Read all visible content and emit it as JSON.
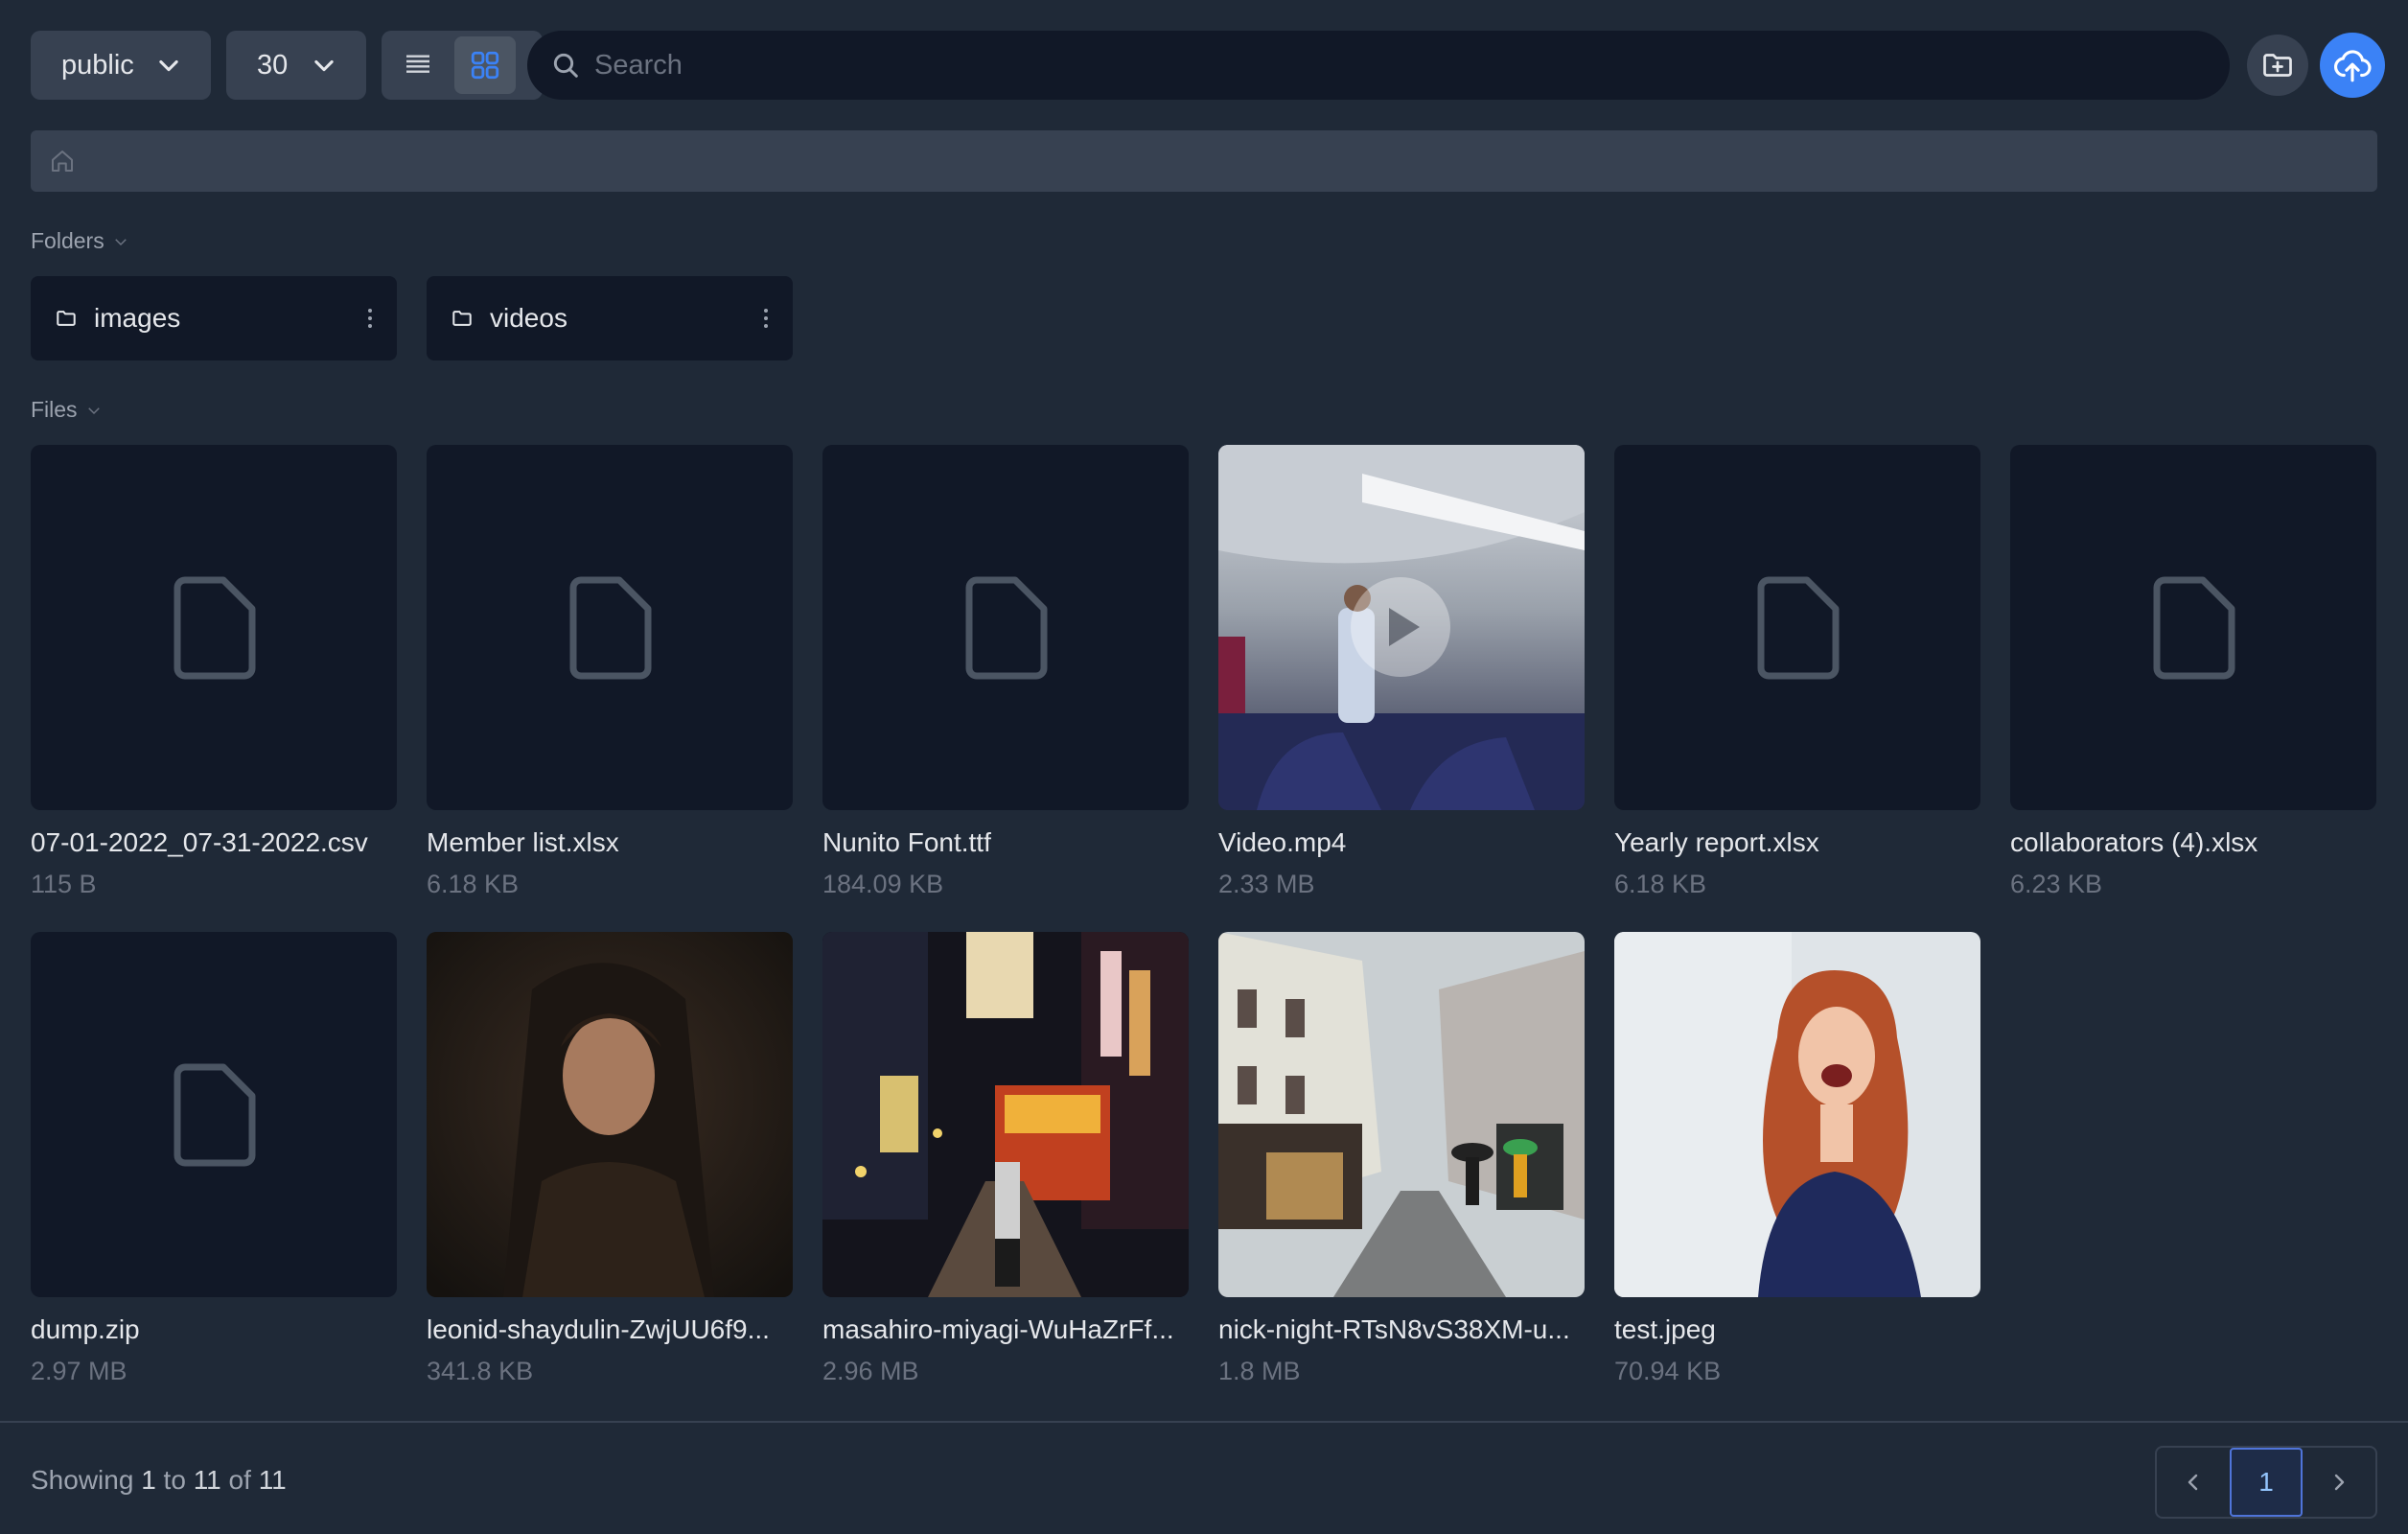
{
  "toolbar": {
    "bucket_select": "public",
    "per_page_select": "30",
    "search_placeholder": "Search"
  },
  "sections": {
    "folders_label": "Folders",
    "files_label": "Files"
  },
  "folders": [
    {
      "name": "images"
    },
    {
      "name": "videos"
    }
  ],
  "files": [
    {
      "name": "07-01-2022_07-31-2022.csv",
      "size": "115 B"
    },
    {
      "name": "Member list.xlsx",
      "size": "6.18 KB"
    },
    {
      "name": "Nunito Font.ttf",
      "size": "184.09 KB"
    },
    {
      "name": "Video.mp4",
      "size": "2.33 MB"
    },
    {
      "name": "Yearly report.xlsx",
      "size": "6.18 KB"
    },
    {
      "name": "collaborators (4).xlsx",
      "size": "6.23 KB"
    },
    {
      "name": "dump.zip",
      "size": "2.97 MB"
    },
    {
      "name": "leonid-shaydulin-ZwjUU6f9...",
      "size": "341.8 KB"
    },
    {
      "name": "masahiro-miyagi-WuHaZrFf...",
      "size": "2.96 MB"
    },
    {
      "name": "nick-night-RTsN8vS38XM-u...",
      "size": "1.8 MB"
    },
    {
      "name": "test.jpeg",
      "size": "70.94 KB"
    }
  ],
  "footer": {
    "showing_prefix": "Showing",
    "from": "1",
    "to_word": "to",
    "to": "11",
    "of_word": "of",
    "total": "11",
    "current_page": "1"
  },
  "colors": {
    "background": "#1f2937",
    "panel": "#374151",
    "card": "#111827",
    "accent": "#3b82f6"
  }
}
